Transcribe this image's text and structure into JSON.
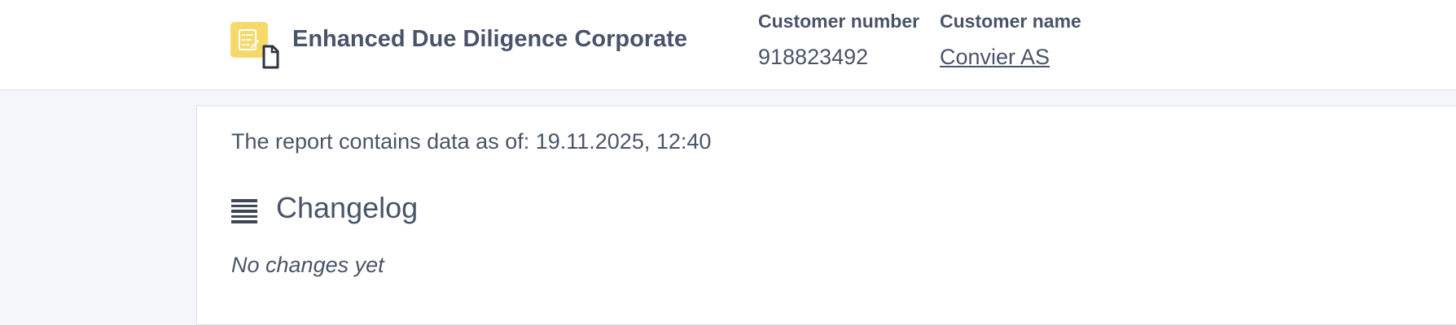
{
  "header": {
    "title": "Enhanced Due Diligence Corporate",
    "icon": "checklist-document-icon",
    "icon_color": "#f5d96b",
    "customer_number_label": "Customer number",
    "customer_number_value": "918823492",
    "customer_name_label": "Customer name",
    "customer_name_value": "Convier AS"
  },
  "report": {
    "date_text": "The report contains data as of: 19.11.2025, 12:40"
  },
  "changelog": {
    "icon": "list-icon",
    "title": "Changelog",
    "empty_text": "No changes yet"
  }
}
